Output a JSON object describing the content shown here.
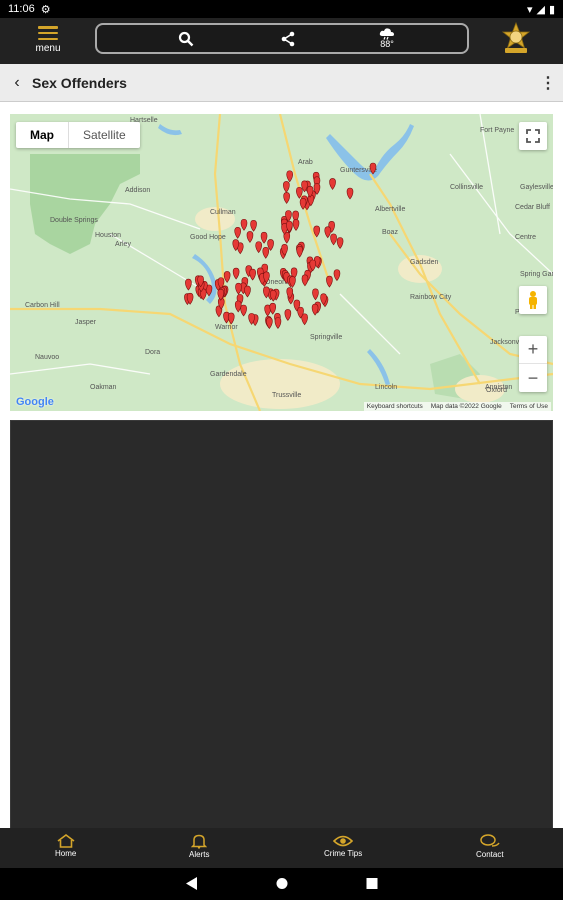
{
  "status_bar": {
    "time": "11:06"
  },
  "header": {
    "menu_label": "menu",
    "weather_temp": "88°"
  },
  "titlebar": {
    "title": "Sex Offenders"
  },
  "map": {
    "type_buttons": [
      "Map",
      "Satellite"
    ],
    "google_logo": "Google",
    "attribution": [
      "Keyboard shortcuts",
      "Map data ©2022 Google",
      "Terms of Use"
    ],
    "marker_color": "#e53935",
    "place_labels": [
      "Hartselle",
      "Arab",
      "Guntersville",
      "Fort Payne",
      "Albertville",
      "Collinsville",
      "Cullman",
      "Boaz",
      "Gadsden",
      "Good Hope",
      "Rainbow City",
      "Jasper",
      "Oneonta",
      "Warrior",
      "Springville",
      "Anniston",
      "Gardendale",
      "Trussville",
      "Oxford",
      "Jacksonville",
      "Lincoln",
      "Addison",
      "Double Springs",
      "Houston",
      "Arley",
      "Carbon Hill",
      "Nauvoo",
      "Oakman",
      "Dora",
      "Cedar Bluff",
      "Gaylesville",
      "Centre",
      "Spring Garden",
      "Piedmont"
    ]
  },
  "bottom_nav": [
    {
      "label": "Home",
      "icon": "home-icon"
    },
    {
      "label": "Alerts",
      "icon": "bell-icon"
    },
    {
      "label": "Crime Tips",
      "icon": "eye-icon"
    },
    {
      "label": "Contact",
      "icon": "chat-icon"
    }
  ],
  "colors": {
    "accent": "#d4a52a",
    "bar": "#222222"
  }
}
